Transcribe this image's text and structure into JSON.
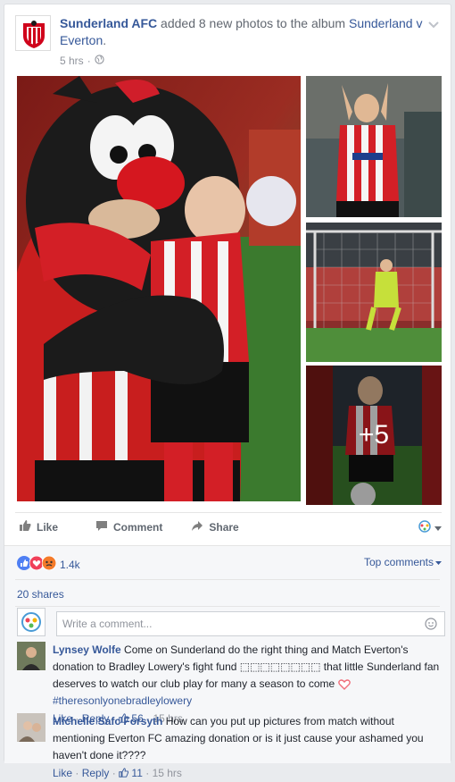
{
  "post": {
    "page_name": "Sunderland AFC",
    "action_text": " added 8 new photos to the album ",
    "album_name_1": "Sunderland v",
    "album_name_2": "Everton",
    "album_period": ".",
    "time": "5 hrs",
    "meta_sep": "·",
    "more_photos": "+5"
  },
  "actions": {
    "like": "Like",
    "comment": "Comment",
    "share": "Share"
  },
  "reactions": {
    "count": "1.4k",
    "top_comments": "Top comments"
  },
  "shares": "20 shares",
  "composer": {
    "placeholder": "Write a comment..."
  },
  "comments": [
    {
      "author": "Lynsey Wolfe",
      "text": "Come on Sunderland do the right thing and Match Everton's donation to Bradley Lowery's fight fund ⬚⬚⬚⬚⬚⬚⬚⬚ that little Sunderland fan deserves to watch our club play for many a season to come",
      "hashtag": "#theresonlyonebradleylowery",
      "like": "Like",
      "reply": "Reply",
      "likes": "56",
      "time": "15 hrs"
    },
    {
      "author": "Michelle Safc Forsyth",
      "text": "How can you put up pictures from match without mentioning Everton FC amazing donation or is it just cause your ashamed you haven't done it????",
      "like": "Like",
      "reply": "Reply",
      "likes": "11",
      "time": "15 hrs"
    }
  ],
  "colors": {
    "link": "#365899",
    "muted": "#90949c",
    "sunderland_red": "#d0021b"
  }
}
